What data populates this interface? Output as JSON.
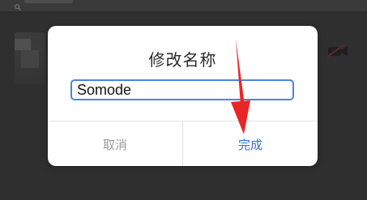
{
  "dialog": {
    "title": "修改名称",
    "input_value": "Somode",
    "cancel_label": "取消",
    "done_label": "完成"
  },
  "colors": {
    "accent_blue": "#2f6fde",
    "input_border": "#4b84e0",
    "arrow_red": "#e82626",
    "overlay": "#2f2f2f"
  },
  "icons": {
    "search": "search-icon",
    "video": "video-off-icon",
    "arrow": "red-arrow-annotation"
  }
}
